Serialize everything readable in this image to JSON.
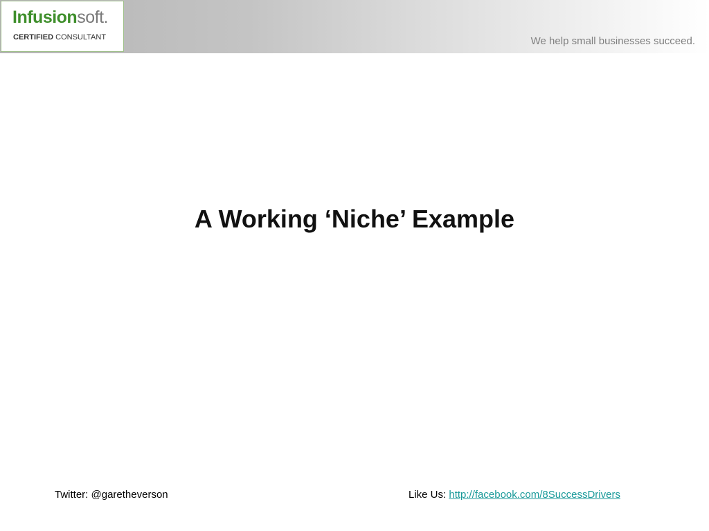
{
  "header": {
    "logo": {
      "word_part1": "Infusion",
      "word_part2": "soft.",
      "subtitle_bold": "CERTIFIED",
      "subtitle_rest": " CONSULTANT"
    },
    "tagline": "We help small businesses succeed."
  },
  "main": {
    "title": "A Working ‘Niche’ Example"
  },
  "footer": {
    "twitter_text": "Twitter: @garetheverson",
    "like_label": "Like Us: ",
    "facebook_link": "http://facebook.com/8SuccessDrivers"
  },
  "colors": {
    "logo_green": "#3f8f2c",
    "link": "#1a9a9a",
    "tagline": "#7f7f7f"
  }
}
